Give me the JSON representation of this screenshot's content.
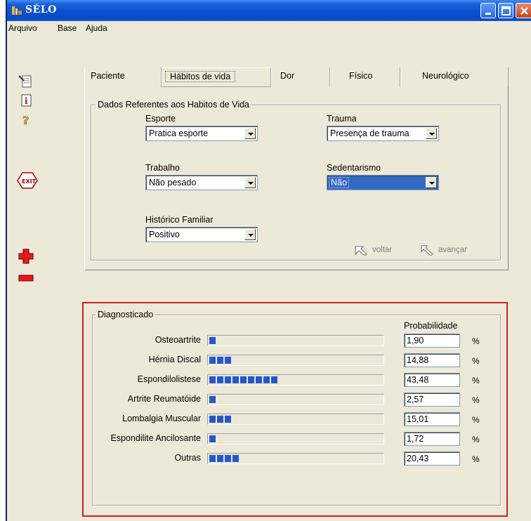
{
  "window": {
    "title": "SÉLO",
    "controls": [
      "minimize",
      "maximize",
      "close"
    ]
  },
  "menu": [
    "Arquivo",
    "Base",
    "Ajuda"
  ],
  "sidebar_icons": [
    "notes-icon",
    "info-icon",
    "help-icon",
    "exit-icon",
    "add-icon",
    "remove-icon"
  ],
  "sidebar_exit_text": "EXIT",
  "tabs": [
    "Paciente",
    "Hábitos de vida",
    "Dor",
    "Físico",
    "Neurológico"
  ],
  "active_tab": "Hábitos de vida",
  "habits": {
    "legend": "Dados Referentes aos Habitos de Vida",
    "esporte": {
      "label": "Esporte",
      "value": "Pratica esporte"
    },
    "trauma": {
      "label": "Trauma",
      "value": "Presença de trauma"
    },
    "trabalho": {
      "label": "Trabalho",
      "value": "Não pesado"
    },
    "sedentarismo": {
      "label": "Sedentarismo",
      "value": "Não"
    },
    "historico": {
      "label": "Histórico Familiar",
      "value": "Positivo"
    },
    "voltar": "voltar",
    "avancar": "avançar"
  },
  "diagnostics": {
    "legend": "Diagnosticado",
    "prob_header": "Probabilidade",
    "unit": "%",
    "rows": [
      {
        "name": "Osteoartrite",
        "value": "1,90",
        "blocks": 1
      },
      {
        "name": "Hérnia Discal",
        "value": "14,88",
        "blocks": 3
      },
      {
        "name": "Espondilolistese",
        "value": "43,48",
        "blocks": 9
      },
      {
        "name": "Artrite Reumatóide",
        "value": "2,57",
        "blocks": 1
      },
      {
        "name": "Lombalgia Muscular",
        "value": "15,01",
        "blocks": 3
      },
      {
        "name": "Espondilite Ancilosante",
        "value": "1,72",
        "blocks": 1
      },
      {
        "name": "Outras",
        "value": "20,43",
        "blocks": 4
      }
    ]
  },
  "colors": {
    "titlebar": "#0a4bc4",
    "highlight_frame": "#d41e24",
    "bar_fill": "#2557cc",
    "selection": "#316ac5"
  }
}
